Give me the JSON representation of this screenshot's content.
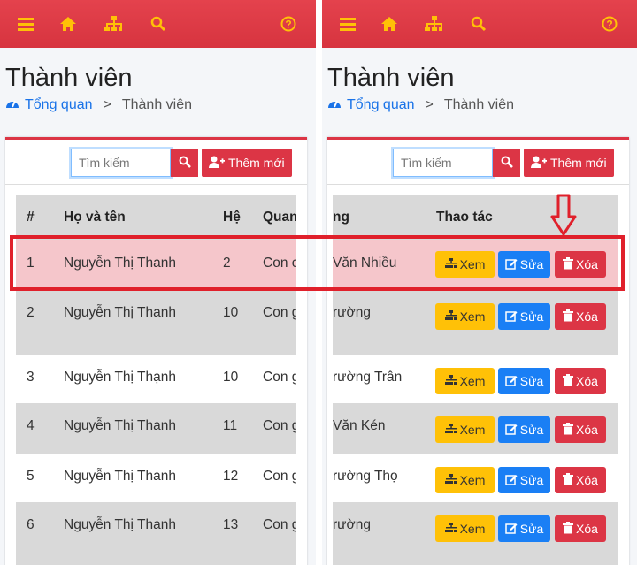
{
  "nav": {
    "icons": [
      "menu-icon",
      "home-icon",
      "sitemap-icon",
      "search-icon",
      "help-icon"
    ]
  },
  "page": {
    "title": "Thành viên",
    "breadcrumb_home": "Tổng quan",
    "breadcrumb_sep": ">",
    "breadcrumb_current": "Thành viên"
  },
  "toolbar": {
    "search_placeholder": "Tìm kiếm",
    "add_label": "Thêm mới"
  },
  "table": {
    "headers": {
      "num": "#",
      "name": "Họ và tên",
      "gen": "Hệ",
      "rel": "Quan",
      "rel_right": "ng",
      "actions": "Thao tác"
    },
    "rows": [
      {
        "num": "1",
        "name": "Nguyễn Thị Thanh",
        "gen": "2",
        "rel": "Con c",
        "partner": "Văn Nhiều"
      },
      {
        "num": "2",
        "name": "Nguyễn Thị Thanh",
        "gen": "10",
        "rel": "Con g",
        "partner": "rường"
      },
      {
        "num": "3",
        "name": "Nguyễn Thị Thạnh",
        "gen": "10",
        "rel": "Con g",
        "partner": "rường Trân"
      },
      {
        "num": "4",
        "name": "Nguyễn Thị Thanh",
        "gen": "11",
        "rel": "Con g",
        "partner": "Văn Kén"
      },
      {
        "num": "5",
        "name": "Nguyễn Thị Thanh",
        "gen": "12",
        "rel": "Con g",
        "partner": "rường Thọ"
      },
      {
        "num": "6",
        "name": "Nguyễn Thị Thanh",
        "gen": "13",
        "rel": "Con g",
        "partner": "rường"
      }
    ],
    "btn_view": "Xem",
    "btn_edit": "Sửa",
    "btn_delete": "Xóa"
  },
  "colors": {
    "primary": "#dc3545",
    "view": "#ffc107",
    "edit": "#1a7ff5",
    "highlight": "#e0202b"
  }
}
